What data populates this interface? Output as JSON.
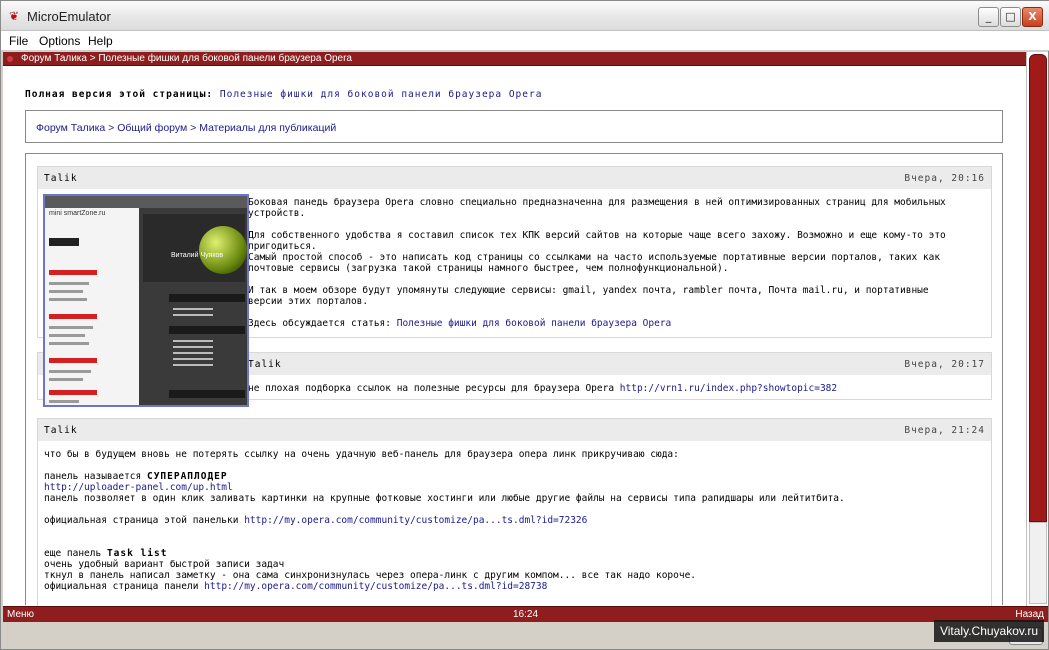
{
  "window": {
    "title": "MicroEmulator",
    "minimize": "_",
    "maximize": "□",
    "close": "X"
  },
  "menu": [
    "File",
    "Options",
    "Help"
  ],
  "header": {
    "title": "Форум Талика > Полезные фишки для боковой панели браузера Opera"
  },
  "full_version": {
    "label": "Полная версия этой страницы:",
    "link": "Полезные фишки для боковой панели браузера Opera"
  },
  "breadcrumb": {
    "text": "Форум Талика > Общий форум > Материалы для публикаций"
  },
  "posts": [
    {
      "author": "Talik",
      "date": "Вчера, 20:16",
      "lines": [
        "Боковая панедь браузера Opera словно специально предназначенна для размещения в ней оптимизированных страниц для мобильных",
        "устройств.",
        "",
        "Для собственного удобства я составил список тех КПК версий сайтов на которые чаще всего захожу. Возможно и еще кому-то это",
        "пригодиться.",
        "Самый простой способ - это написать код страницы со ссылками на часто используемые портативные версии порталов, таких как",
        "почтовые сервисы (загрузка такой страницы намного быстрее, чем полнофункциональной).",
        "",
        "И так в моем обзоре будут упомянуты следующие сервисы: gmail, yandex почта, rambler почта, Почта mail.ru, и портативные",
        "версии этих порталов."
      ],
      "discuss_label": "Здесь обсуждается статья:",
      "discuss_link": "Полезные фишки для боковой панели браузера Opera"
    },
    {
      "author": "Talik",
      "date": "Вчера, 20:17",
      "text": "не плохая подборка ссылок на полезные ресурсы для браузера Opera",
      "link": "http://vrn1.ru/index.php?showtopic=382"
    },
    {
      "author": "Talik",
      "date": "Вчера, 21:24",
      "intro": "что бы в будущем вновь не потерять ссылку на очень удачную веб-панель для браузера опера линк прикручиваю сюда:",
      "panel1_label": "панель называется",
      "panel1_name": "СУПЕРАПЛОДЕР",
      "panel1_url": "http://uploader-panel.com/up.html",
      "panel1_desc": "панель позволяет в один клик заливать картинки на крупные фотковые хостинги или любые другие файлы на сервисы типа рапидшары или лейтитбита.",
      "panel1_official_label": "официальная страница этой панельки",
      "panel1_official_url": "http://my.opera.com/community/customize/pa...ts.dml?id=72326",
      "panel2_label": "еще панель",
      "panel2_name": "Task list",
      "panel2_line1": "очень удобный вариант быстрой записи задач",
      "panel2_line2": "ткнул в панель написал заметку - она сама синхронизнулась через опера-линк с другим компом... все так надо короче.",
      "panel2_official_label": "официальная страница панели",
      "panel2_official_url": "http://my.opera.com/community/customize/pa...ts.dml?id=28738"
    }
  ],
  "thumbnail": {
    "site_name": "mini smartZone.ru",
    "banner": "Виталий Чуяков"
  },
  "softkeys": {
    "left": "Меню",
    "center": "16:24",
    "right": "Назад"
  },
  "watermark": "Vitaly.Chuyakov.ru"
}
